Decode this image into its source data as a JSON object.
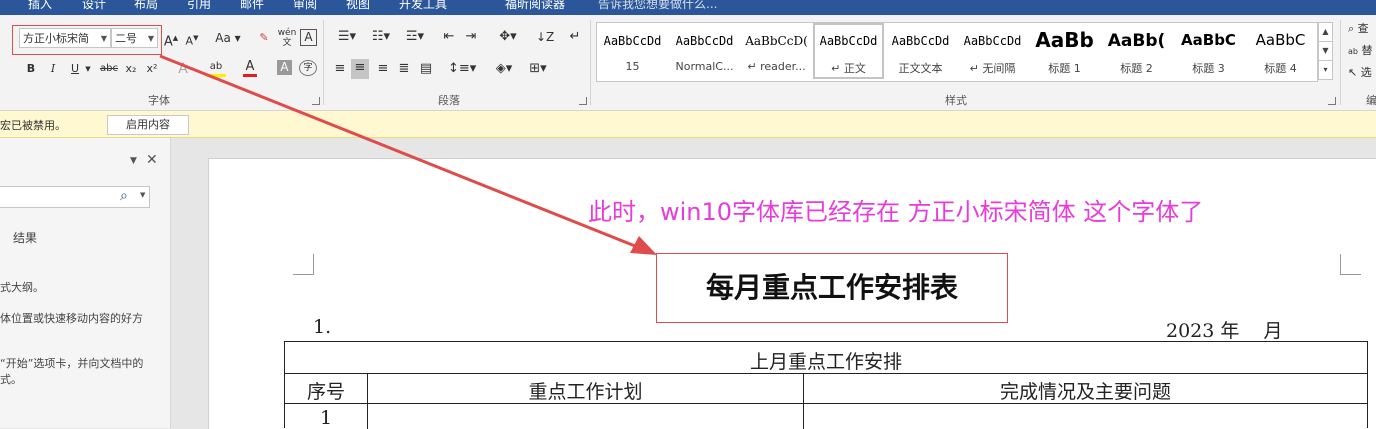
{
  "tabs": [
    "插入",
    "设计",
    "布局",
    "引用",
    "邮件",
    "审阅",
    "视图",
    "开发工具",
    "福昕阅读器",
    "告诉我您想要做什么..."
  ],
  "font": {
    "name": "方正小标宋简",
    "size": "二号",
    "buttons": {
      "bold": "B",
      "italic": "I",
      "underline": "U",
      "strike": "abc",
      "subscript": "x₂",
      "superscript": "x²",
      "grow": "A",
      "shrink": "A",
      "case": "Aa",
      "clear": "A",
      "phonetic": "wén",
      "border_char": "A",
      "highlight": "ab",
      "color": "A",
      "shade": "A",
      "enclose": "字"
    },
    "group_label": "字体"
  },
  "paragraph": {
    "group_label": "段落"
  },
  "styles": {
    "group_label": "样式",
    "items": [
      {
        "sample": "AaBbCcDd",
        "name": "15"
      },
      {
        "sample": "AaBbCcDd",
        "name": "NormalC..."
      },
      {
        "sample": "AaBbCcD(",
        "name": "reader..."
      },
      {
        "sample": "AaBbCcDd",
        "name": "正文"
      },
      {
        "sample": "AaBbCcDd",
        "name": "正文文本"
      },
      {
        "sample": "AaBbCcDd",
        "name": "无间隔"
      },
      {
        "sample": "AaBb",
        "name": "标题 1"
      },
      {
        "sample": "AaBb(",
        "name": "标题 2"
      },
      {
        "sample": "AaBbC",
        "name": "标题 3"
      },
      {
        "sample": "AaBbC",
        "name": "标题 4"
      }
    ],
    "selected_index": 3
  },
  "editing": {
    "find": "查",
    "replace": "替",
    "select": "选",
    "group_label": "编"
  },
  "message_bar": {
    "text": "宏已被禁用。",
    "button": "启用内容"
  },
  "nav_pane": {
    "results_tab": "结果",
    "lines": [
      "式大纲。",
      "体位置或快速移动内容的好方",
      "“开始”选项卡，并向文档中的",
      "式。"
    ]
  },
  "annotation": "此时，win10字体库已经存在 方正小标宋简体 这个字体了",
  "annotation_color": "#e63cd9",
  "highlight_color": "#e04b4b",
  "document": {
    "title": "每月重点工作安排表",
    "list_marker": "1.",
    "date_text": "2023 年    月",
    "table": {
      "caption": "上月重点工作安排",
      "headers": [
        "序号",
        "重点工作计划",
        "完成情况及主要问题"
      ],
      "rows": [
        [
          "1",
          "",
          ""
        ]
      ]
    }
  }
}
